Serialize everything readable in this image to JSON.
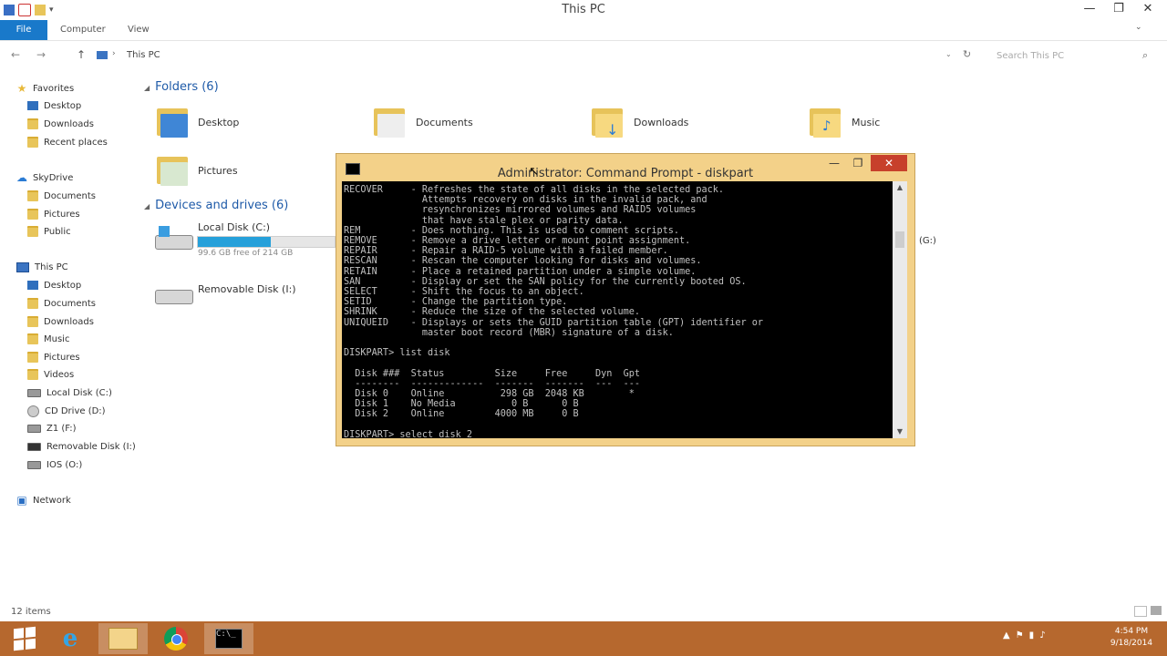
{
  "window": {
    "title": "This PC",
    "minimize": "—",
    "maximize": "❐",
    "close": "✕"
  },
  "ribbon": {
    "file": "File",
    "computer": "Computer",
    "view": "View"
  },
  "address": {
    "back": "←",
    "forward": "→",
    "up": "↑",
    "path": "This PC",
    "search_placeholder": "Search This PC"
  },
  "nav": {
    "favorites": "Favorites",
    "fav_items": [
      "Desktop",
      "Downloads",
      "Recent places"
    ],
    "skydrive": "SkyDrive",
    "sky_items": [
      "Documents",
      "Pictures",
      "Public"
    ],
    "thispc": "This PC",
    "pc_items": [
      "Desktop",
      "Documents",
      "Downloads",
      "Music",
      "Pictures",
      "Videos",
      "Local Disk (C:)",
      "CD Drive (D:)",
      "Z1 (F:)",
      "Removable Disk (I:)",
      "IOS (O:)"
    ],
    "network": "Network"
  },
  "content": {
    "folders_header": "Folders (6)",
    "folders": [
      "Desktop",
      "Documents",
      "Downloads",
      "Music",
      "Pictures"
    ],
    "devices_header": "Devices and drives (6)",
    "local_disk": {
      "name": "Local Disk (C:)",
      "free": "99.6 GB free of 214 GB",
      "used_fraction": 0.535
    },
    "removable_disk": "Removable Disk (I:)",
    "hidden_drive": "(G:)"
  },
  "cmd": {
    "title": "Administrator: Command Prompt - diskpart",
    "lines": [
      "RECOVER     - Refreshes the state of all disks in the selected pack.",
      "              Attempts recovery on disks in the invalid pack, and",
      "              resynchronizes mirrored volumes and RAID5 volumes",
      "              that have stale plex or parity data.",
      "REM         - Does nothing. This is used to comment scripts.",
      "REMOVE      - Remove a drive letter or mount point assignment.",
      "REPAIR      - Repair a RAID-5 volume with a failed member.",
      "RESCAN      - Rescan the computer looking for disks and volumes.",
      "RETAIN      - Place a retained partition under a simple volume.",
      "SAN         - Display or set the SAN policy for the currently booted OS.",
      "SELECT      - Shift the focus to an object.",
      "SETID       - Change the partition type.",
      "SHRINK      - Reduce the size of the selected volume.",
      "UNIQUEID    - Displays or sets the GUID partition table (GPT) identifier or",
      "              master boot record (MBR) signature of a disk.",
      "",
      "DISKPART> list disk",
      "",
      "  Disk ###  Status         Size     Free     Dyn  Gpt",
      "  --------  -------------  -------  -------  ---  ---",
      "  Disk 0    Online          298 GB  2048 KB        *",
      "  Disk 1    No Media          0 B      0 B",
      "  Disk 2    Online         4000 MB     0 B",
      "",
      "DISKPART> select disk 2"
    ]
  },
  "status": {
    "items": "12 items"
  },
  "taskbar": {
    "time": "4:54 PM",
    "date": "9/18/2014",
    "ie_glyph": "e",
    "cmd_glyph": "C:\\_"
  }
}
